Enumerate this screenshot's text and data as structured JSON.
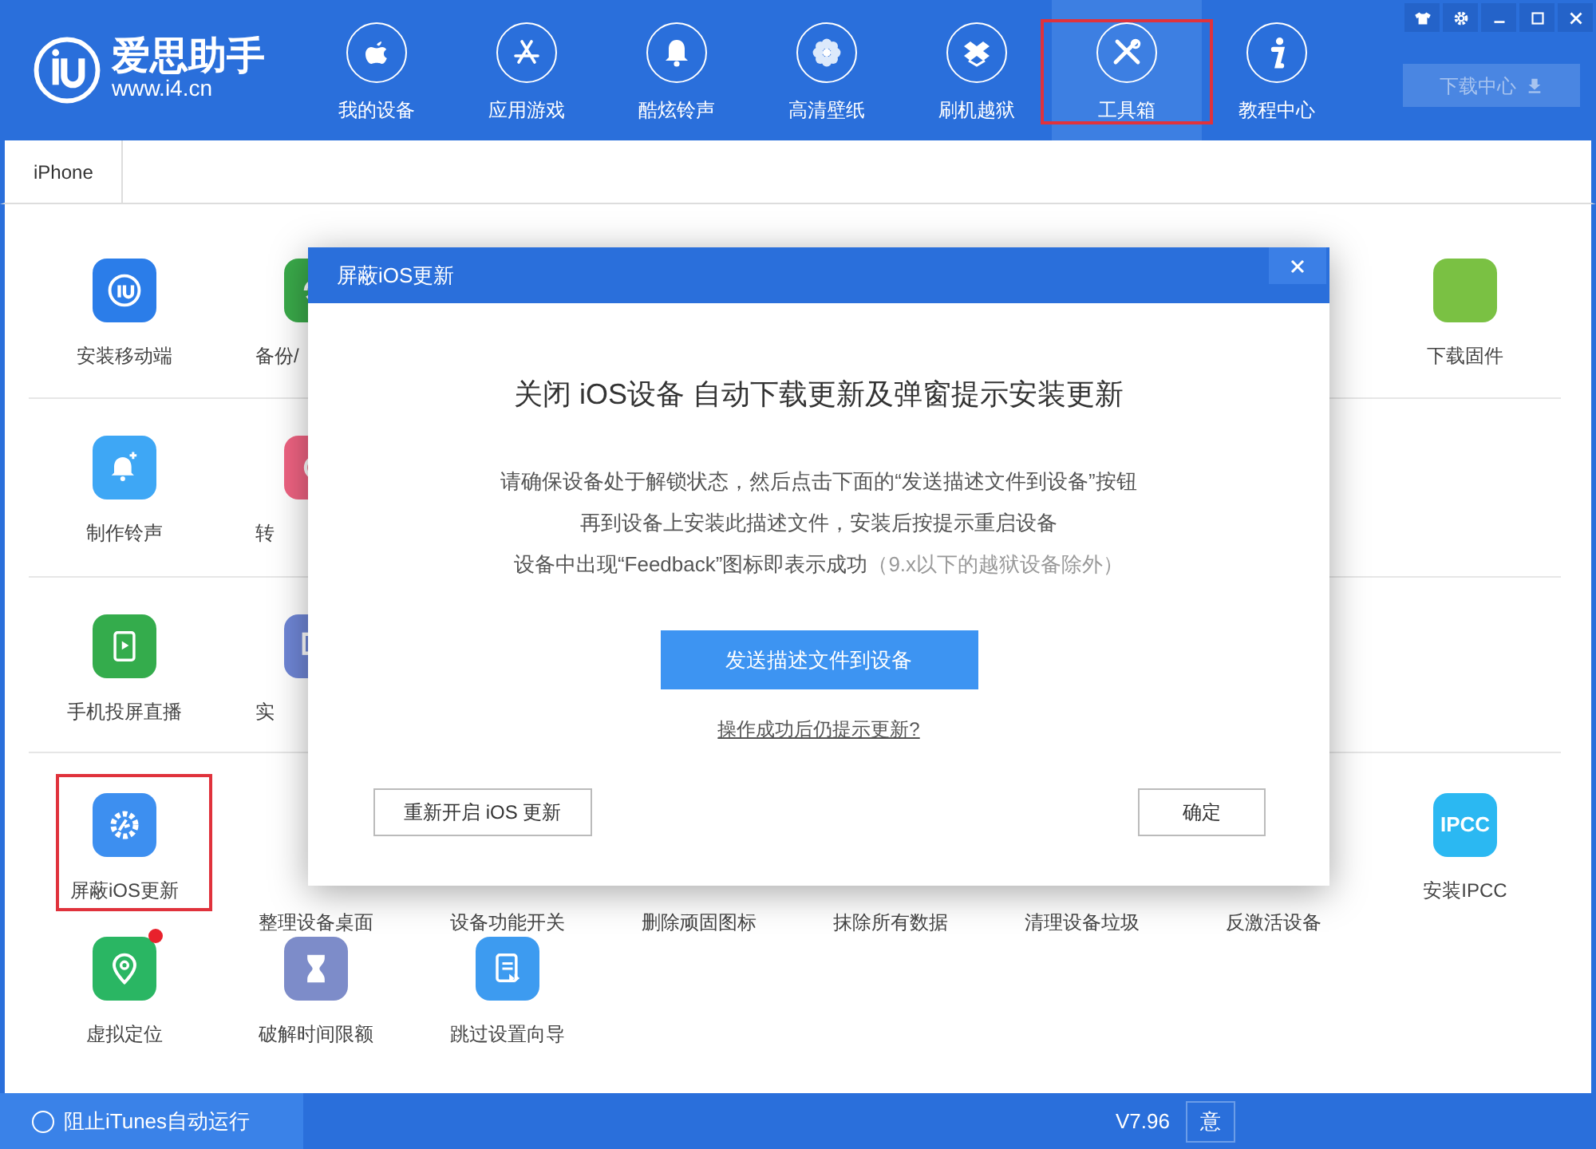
{
  "app": {
    "brand": "爱思助手",
    "url": "www.i4.cn"
  },
  "nav": [
    {
      "label": "我的设备",
      "selected": false,
      "highlighted": false
    },
    {
      "label": "应用游戏",
      "selected": false,
      "highlighted": false
    },
    {
      "label": "酷炫铃声",
      "selected": false,
      "highlighted": false
    },
    {
      "label": "高清壁纸",
      "selected": false,
      "highlighted": false
    },
    {
      "label": "刷机越狱",
      "selected": false,
      "highlighted": false
    },
    {
      "label": "工具箱",
      "selected": true,
      "highlighted": true
    },
    {
      "label": "教程中心",
      "selected": false,
      "highlighted": false
    }
  ],
  "download_button": {
    "label": "下载中心",
    "disabled": true
  },
  "tabs": [
    {
      "label": "iPhone",
      "selected": true
    }
  ],
  "tools": [
    [
      {
        "kind": "tool",
        "label": "安装移动端",
        "color": "#2b7de9",
        "highlighted": false,
        "dot": false
      },
      {
        "kind": "partial",
        "label": "备份/",
        "color": "#3aaa4a"
      },
      {
        "kind": "tool",
        "label": "下载固件",
        "color": "#7ac143",
        "highlighted": false,
        "dot": false
      }
    ],
    [
      {
        "kind": "tool",
        "label": "制作铃声",
        "color": "#3ea7f5",
        "highlighted": false,
        "dot": false
      },
      {
        "kind": "partial",
        "label": "转",
        "color": "#ef6382"
      }
    ],
    [
      {
        "kind": "tool",
        "label": "手机投屏直播",
        "color": "#34ac4c",
        "highlighted": false,
        "dot": false
      },
      {
        "kind": "partial",
        "label": "实",
        "color": "#6f86d6"
      }
    ],
    [
      {
        "kind": "tool",
        "label": "屏蔽iOS更新",
        "color": "#3d8ff0",
        "highlighted": true,
        "dot": false
      },
      {
        "kind": "label",
        "label": "整理设备桌面"
      },
      {
        "kind": "label",
        "label": "设备功能开关"
      },
      {
        "kind": "label",
        "label": "删除顽固图标"
      },
      {
        "kind": "label",
        "label": "抹除所有数据"
      },
      {
        "kind": "label",
        "label": "清理设备垃圾"
      },
      {
        "kind": "label",
        "label": "反激活设备"
      },
      {
        "kind": "tool",
        "label": "安装IPCC",
        "color": "#2bb8f2",
        "highlighted": false,
        "dot": false,
        "icon_text": "IPCC"
      }
    ],
    [
      {
        "kind": "tool",
        "label": "虚拟定位",
        "color": "#2ab663",
        "highlighted": false,
        "dot": true
      },
      {
        "kind": "tool",
        "label": "破解时间限额",
        "color": "#7d8cc9",
        "highlighted": false,
        "dot": false
      },
      {
        "kind": "tool",
        "label": "跳过设置向导",
        "color": "#3d9bf0",
        "highlighted": false,
        "dot": false
      }
    ]
  ],
  "dialog": {
    "title": "屏蔽iOS更新",
    "heading": "关闭 iOS设备 自动下载更新及弹窗提示安装更新",
    "lines": [
      "请确保设备处于解锁状态，然后点击下面的“发送描述文件到设备”按钮",
      "再到设备上安装此描述文件，安装后按提示重启设备",
      "设备中出现“Feedback”图标即表示成功"
    ],
    "note": "（9.x以下的越狱设备除外）",
    "primary_button": "发送描述文件到设备",
    "link": "操作成功后仍提示更新?",
    "secondary_button": "重新开启 iOS 更新",
    "ok_button": "确定"
  },
  "status_bar": {
    "itunes_block": {
      "label": "阻止iTunes自动运行",
      "checked": false
    },
    "version": "V7.96",
    "feedback_button": "意"
  }
}
